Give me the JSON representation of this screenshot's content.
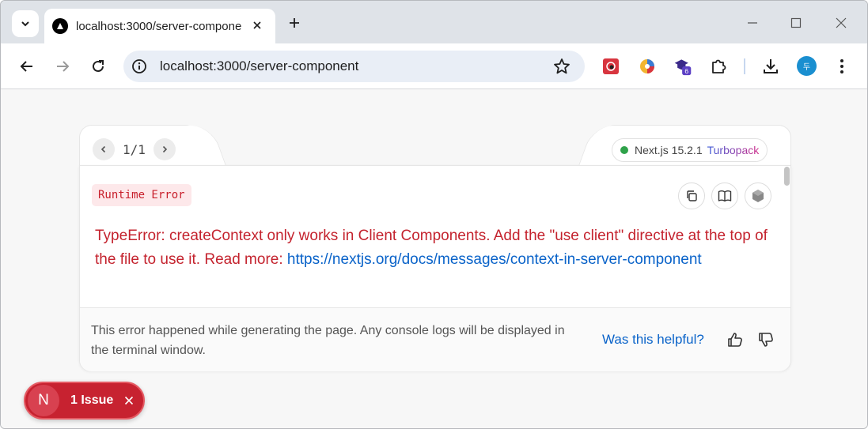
{
  "browser": {
    "tab": {
      "title": "localhost:3000/server-compone",
      "close_glyph": "×"
    },
    "new_tab_glyph": "+",
    "url": "localhost:3000/server-component",
    "profile_initial": "두",
    "extension_badge": "6"
  },
  "overlay": {
    "pager": "1/1",
    "version": "Next.js 15.2.1",
    "bundler": "Turbopack",
    "error_label": "Runtime Error",
    "message_prefix": "TypeError: createContext only works in Client Components. Add the \"use client\" directive at the top of the file to use it. Read more: ",
    "message_link": "https://nextjs.org/docs/messages/context-in-server-component",
    "footer_text": "This error happened while generating the page. Any console logs will be displayed in the terminal window.",
    "helpful_label": "Was this helpful?"
  },
  "issue_indicator": {
    "initial": "N",
    "label": "1 Issue"
  },
  "colors": {
    "error_red": "#c4232e",
    "link_blue": "#0a63c9",
    "indicator_red": "#c72230"
  }
}
